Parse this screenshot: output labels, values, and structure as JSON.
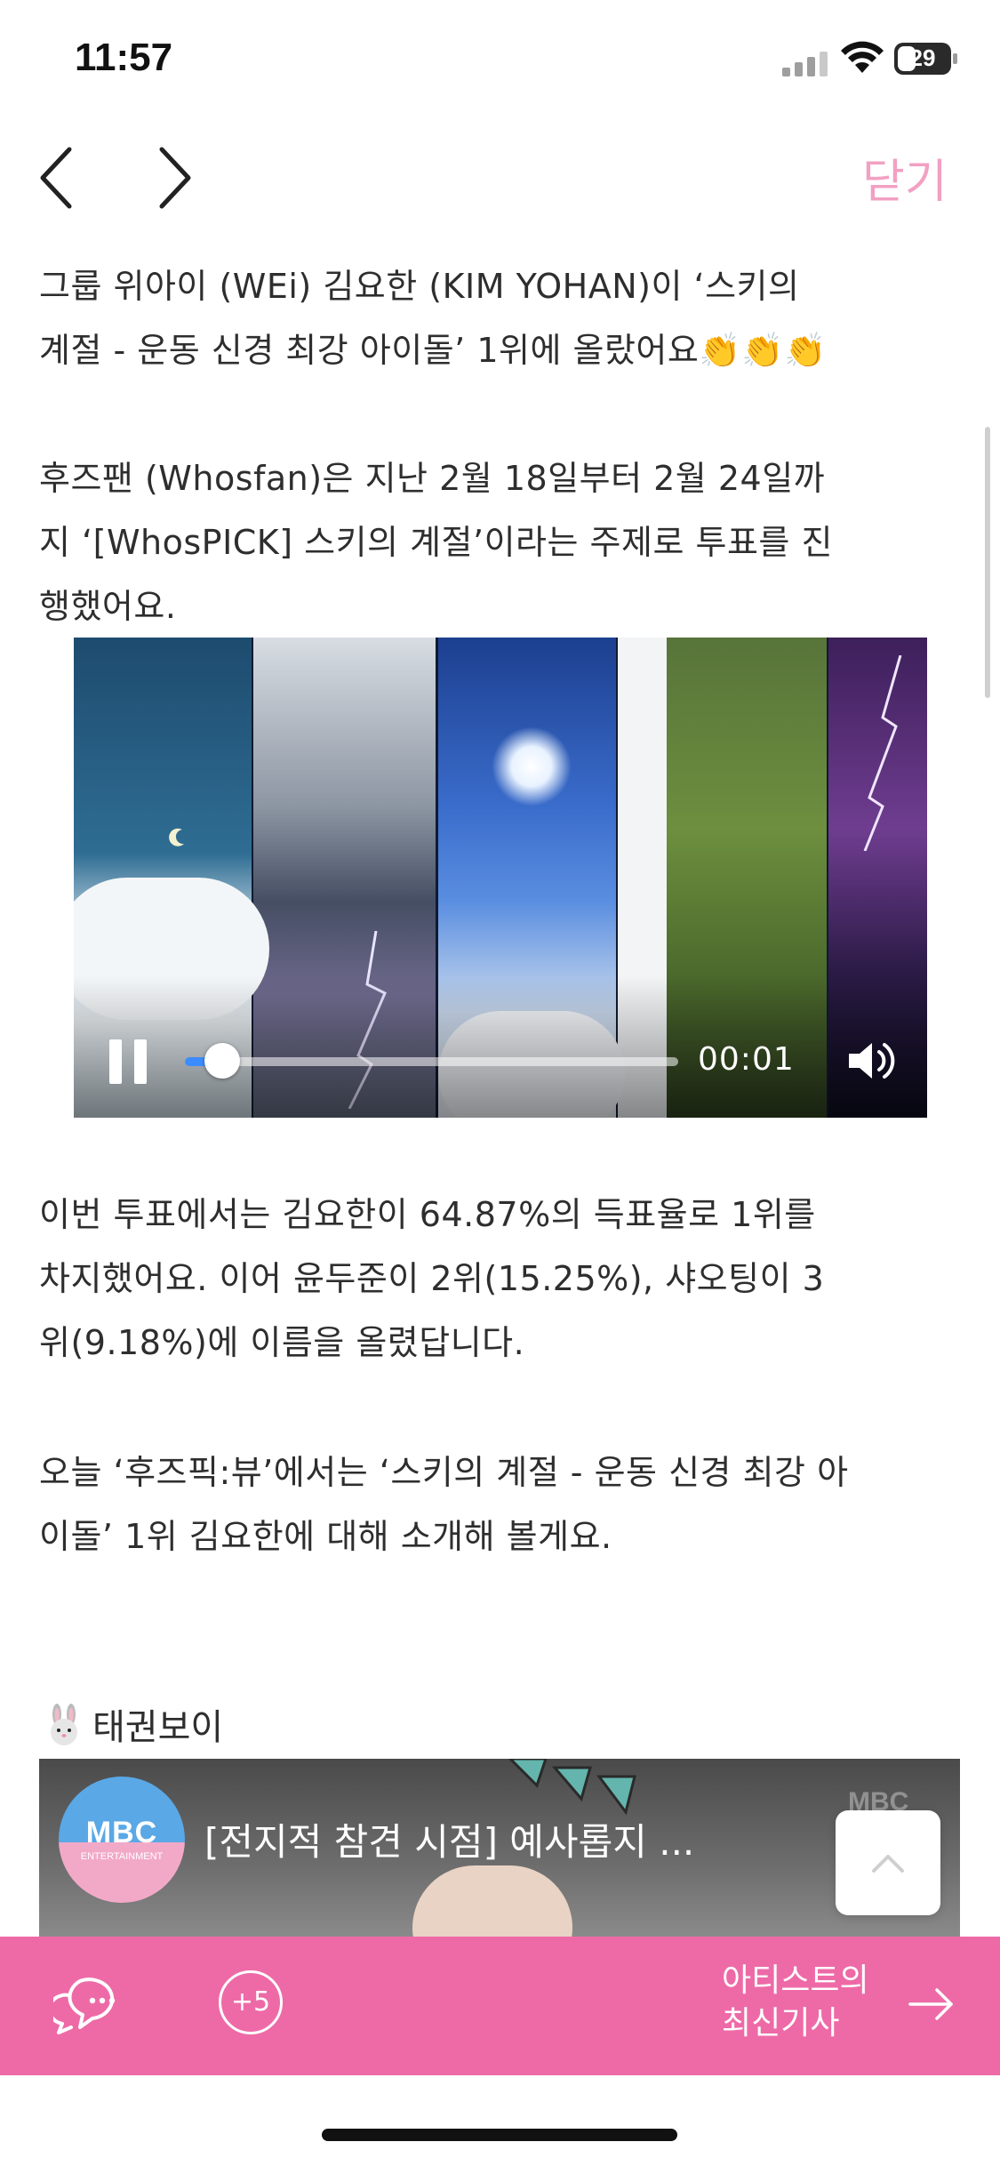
{
  "status_bar": {
    "time": "11:57",
    "battery": "29"
  },
  "header": {
    "close_label": "닫기"
  },
  "article": {
    "paragraph_1_lines": [
      "그룹 위아이 (WEi) 김요한 (KIM YOHAN)이 ‘스키의",
      "계절 - 운동 신경 최강 아이돌’ 1위에 올랐어요👏👏👏"
    ],
    "paragraph_2_lines": [
      "후즈팬 (Whosfan)은 지난 2월 18일부터 2월 24일까",
      "지 ‘[WhosPICK] 스키의 계절’이라는 주제로 투표를 진",
      "행했어요."
    ],
    "paragraph_3_lines": [
      "이번 투표에서는 김요한이 64.87%의 득표율로 1위를",
      "차지했어요. 이어 윤두준이 2위(15.25%), 샤오팅이 3",
      "위(9.18%)에 이름을 올렸답니다."
    ],
    "paragraph_4_lines": [
      "오늘 ‘후즈픽:뷰’에서는 ‘스키의 계절 - 운동 신경 최강 아",
      "이돌’ 1위 김요한에 대해 소개해 볼게요."
    ],
    "section_label": "태권보이"
  },
  "video_player": {
    "time": "00:01",
    "progress": 0.04
  },
  "embed": {
    "title": "[전지적 참견 시점] 예사롭지 ...",
    "channel_logo": "MBC",
    "channel_sub": "ENTERTAINMENT",
    "watermark": "MBC"
  },
  "bottom_bar": {
    "plus_label": "+5",
    "latest_line_1": "아티스트의",
    "latest_line_2": "최신기사"
  },
  "colors": {
    "accent": "#ee6aa7",
    "close": "#f2a0c3"
  }
}
